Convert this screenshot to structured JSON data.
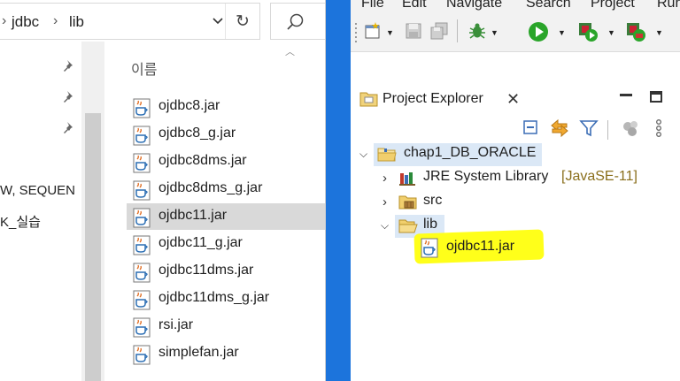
{
  "explorer": {
    "address_path": [
      "jdbc",
      "lib"
    ],
    "column_header": "이름",
    "nav_items": [
      {
        "label": "W, SEQUEN"
      },
      {
        "label": "K_실습"
      }
    ],
    "files": [
      {
        "name": "ojdbc8.jar",
        "selected": false
      },
      {
        "name": "ojdbc8_g.jar",
        "selected": false
      },
      {
        "name": "ojdbc8dms.jar",
        "selected": false
      },
      {
        "name": "ojdbc8dms_g.jar",
        "selected": false
      },
      {
        "name": "ojdbc11.jar",
        "selected": true
      },
      {
        "name": "ojdbc11_g.jar",
        "selected": false
      },
      {
        "name": "ojdbc11dms.jar",
        "selected": false
      },
      {
        "name": "ojdbc11dms_g.jar",
        "selected": false
      },
      {
        "name": "rsi.jar",
        "selected": false
      },
      {
        "name": "simplefan.jar",
        "selected": false
      }
    ]
  },
  "eclipse": {
    "menus": [
      "File",
      "Edit",
      "Navigate",
      "Search",
      "Project",
      "Run"
    ],
    "view_title": "Project Explorer",
    "tree": {
      "project": "chap1_DB_ORACLE",
      "jre_label": "JRE System Library",
      "jre_decoration": "[JavaSE-11]",
      "src_label": "src",
      "lib_label": "lib",
      "lib_child": "ojdbc11.jar"
    },
    "highlight_color": "#ffff1a"
  }
}
